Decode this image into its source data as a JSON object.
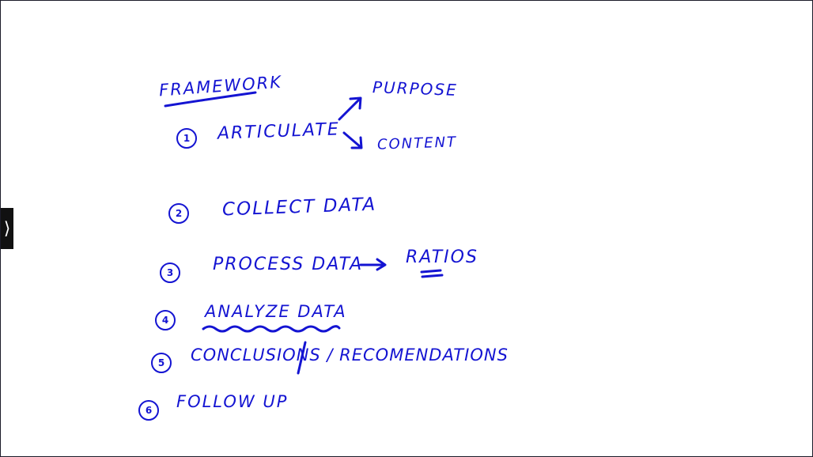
{
  "whiteboard": {
    "title": "FRAMEWORK",
    "steps": [
      {
        "number": "1",
        "text": "ARTICULATE"
      },
      {
        "number": "2",
        "text": "COLLECT DATA"
      },
      {
        "number": "3",
        "text": "PROCESS DATA"
      },
      {
        "number": "4",
        "text": "ANALYZE DATA"
      },
      {
        "number": "5",
        "text": "CONCLUSIONS / RECOMENDATIONS"
      },
      {
        "number": "6",
        "text": "FOLLOW UP"
      }
    ],
    "branches": {
      "purpose": "PURPOSE",
      "content": "CONTENT"
    },
    "ratios": "RATIOS"
  },
  "nav": {
    "expand_glyph": "⟩"
  },
  "colors": {
    "ink": "#1414d2",
    "background": "#ffffff",
    "tab": "#111111"
  }
}
